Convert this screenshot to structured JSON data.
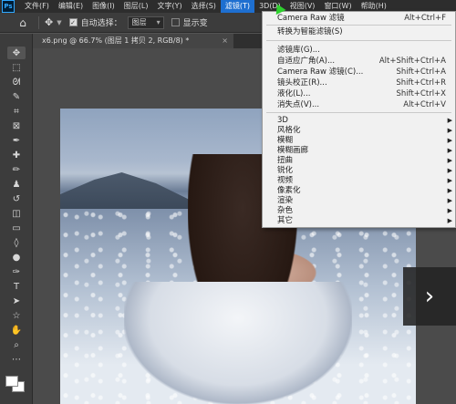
{
  "menubar": {
    "logo": "Ps",
    "items": [
      "文件(F)",
      "编辑(E)",
      "图像(I)",
      "图层(L)",
      "文字(Y)",
      "选择(S)",
      "滤镜(T)",
      "3D(D)",
      "视图(V)",
      "窗口(W)",
      "帮助(H)"
    ],
    "active_index": 6
  },
  "options": {
    "auto_select_label": "自动选择：",
    "auto_select_value": "图层",
    "show_transform_label": "显示变"
  },
  "document": {
    "tab_title": "x6.png @ 66.7% (图层 1 拷贝 2, RGB/8) *",
    "close": "×"
  },
  "filter_menu": {
    "items": [
      {
        "label": "Camera Raw 滤镜",
        "shortcut": "Alt+Ctrl+F",
        "submenu": false
      },
      {
        "label": "转换为智能滤镜(S)",
        "shortcut": "",
        "submenu": false
      },
      {
        "label": "滤镜库(G)...",
        "shortcut": "",
        "submenu": false
      },
      {
        "label": "自适应广角(A)...",
        "shortcut": "Alt+Shift+Ctrl+A",
        "submenu": false
      },
      {
        "label": "Camera Raw 滤镜(C)...",
        "shortcut": "Shift+Ctrl+A",
        "submenu": false
      },
      {
        "label": "镜头校正(R)...",
        "shortcut": "Shift+Ctrl+R",
        "submenu": false
      },
      {
        "label": "液化(L)...",
        "shortcut": "Shift+Ctrl+X",
        "submenu": false
      },
      {
        "label": "消失点(V)...",
        "shortcut": "Alt+Ctrl+V",
        "submenu": false
      },
      {
        "label": "3D",
        "shortcut": "",
        "submenu": true
      },
      {
        "label": "风格化",
        "shortcut": "",
        "submenu": true
      },
      {
        "label": "模糊",
        "shortcut": "",
        "submenu": true
      },
      {
        "label": "模糊画廊",
        "shortcut": "",
        "submenu": true
      },
      {
        "label": "扭曲",
        "shortcut": "",
        "submenu": true
      },
      {
        "label": "锐化",
        "shortcut": "",
        "submenu": true
      },
      {
        "label": "视频",
        "shortcut": "",
        "submenu": true
      },
      {
        "label": "像素化",
        "shortcut": "",
        "submenu": true
      },
      {
        "label": "渲染",
        "shortcut": "",
        "submenu": true
      },
      {
        "label": "杂色",
        "shortcut": "",
        "submenu": true
      },
      {
        "label": "其它",
        "shortcut": "",
        "submenu": true
      }
    ]
  },
  "viewer": {
    "next_label": "›"
  },
  "colors": {
    "menu_highlight": "#1e6fd0",
    "menu_bg": "#f1f1f1",
    "ui_dark": "#3c3c3c"
  }
}
